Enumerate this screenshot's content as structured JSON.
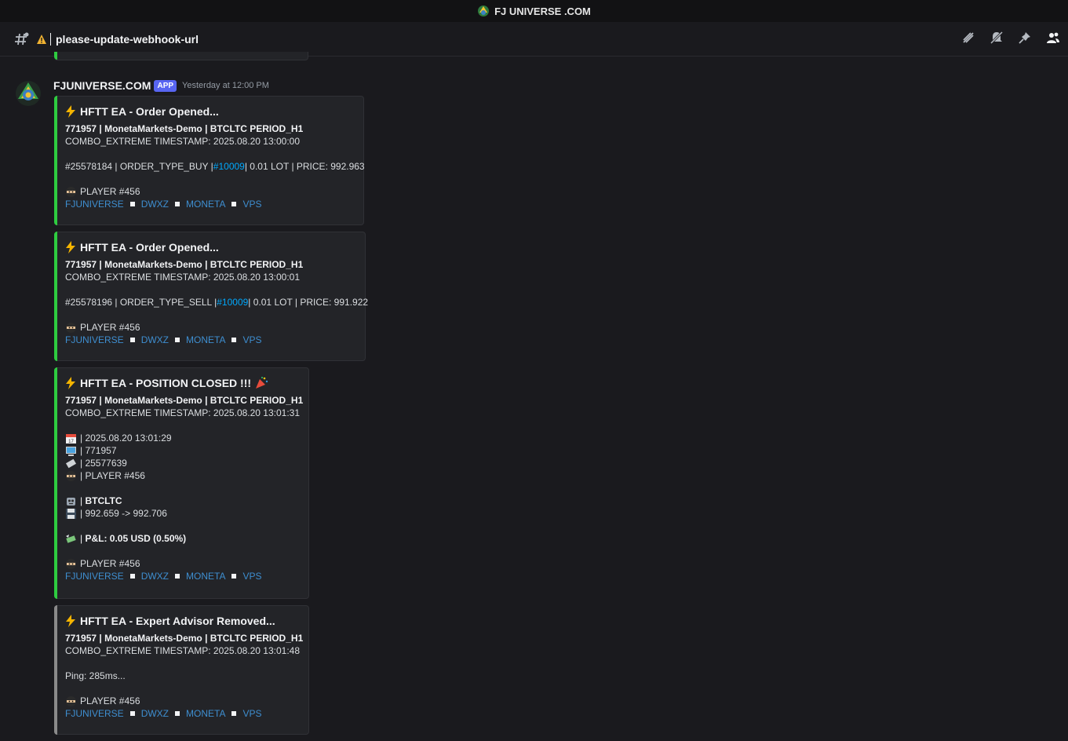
{
  "window": {
    "title": "FJ UNIVERSE .COM"
  },
  "channel": {
    "name": "please-update-webhook-url"
  },
  "colors": {
    "accent_green": "#2ecc40",
    "accent_gray": "#8a8a8a",
    "link": "#00a8fc",
    "badge": "#5865f2"
  },
  "message": {
    "author": "FJUNIVERSE.COM",
    "badge": "APP",
    "timestamp": "Yesterday at 12:00 PM",
    "embeds": [
      {
        "title": "HFTT EA - Order Opened...",
        "line1": "771957 | MonetaMarkets-Demo | BTCLTC PERIOD_H1",
        "line2": "COMBO_EXTREME TIMESTAMP: 2025.08.20 13:00:00",
        "order_pre": "#25578184 | ORDER_TYPE_BUY | ",
        "order_link": "#10009",
        "order_post": " | 0.01 LOT | PRICE: 992.963",
        "player": "PLAYER #456",
        "links": [
          "FJUNIVERSE",
          "DWXZ",
          "MONETA",
          "VPS"
        ]
      },
      {
        "title": "HFTT EA - Order Opened...",
        "line1": "771957 | MonetaMarkets-Demo | BTCLTC PERIOD_H1",
        "line2": "COMBO_EXTREME TIMESTAMP: 2025.08.20 13:00:01",
        "order_pre": "#25578196 | ORDER_TYPE_SELL | ",
        "order_link": "#10009",
        "order_post": " | 0.01 LOT | PRICE: 991.922",
        "player": "PLAYER #456",
        "links": [
          "FJUNIVERSE",
          "DWXZ",
          "MONETA",
          "VPS"
        ]
      },
      {
        "title": "HFTT EA - POSITION CLOSED !!!",
        "line1": "771957 | MonetaMarkets-Demo | BTCLTC PERIOD_H1",
        "line2": "COMBO_EXTREME TIMESTAMP: 2025.08.20 13:01:31",
        "date": "| 2025.08.20 13:01:29",
        "account": "| 771957",
        "ticket": "| 25577639",
        "player_line": "| PLAYER #456",
        "symbol": "BTCLTC",
        "prices": "| 992.659 -> 992.706",
        "pnl": "P&L: 0.05 USD (0.50%)",
        "player": "PLAYER #456",
        "links": [
          "FJUNIVERSE",
          "DWXZ",
          "MONETA",
          "VPS"
        ]
      },
      {
        "title": "HFTT EA - Expert Advisor Removed...",
        "line1": "771957 | MonetaMarkets-Demo | BTCLTC PERIOD_H1",
        "line2": "COMBO_EXTREME TIMESTAMP: 2025.08.20 13:01:48",
        "ping": "Ping: 285ms...",
        "player": "PLAYER #456",
        "links": [
          "FJUNIVERSE",
          "DWXZ",
          "MONETA",
          "VPS"
        ]
      }
    ]
  }
}
